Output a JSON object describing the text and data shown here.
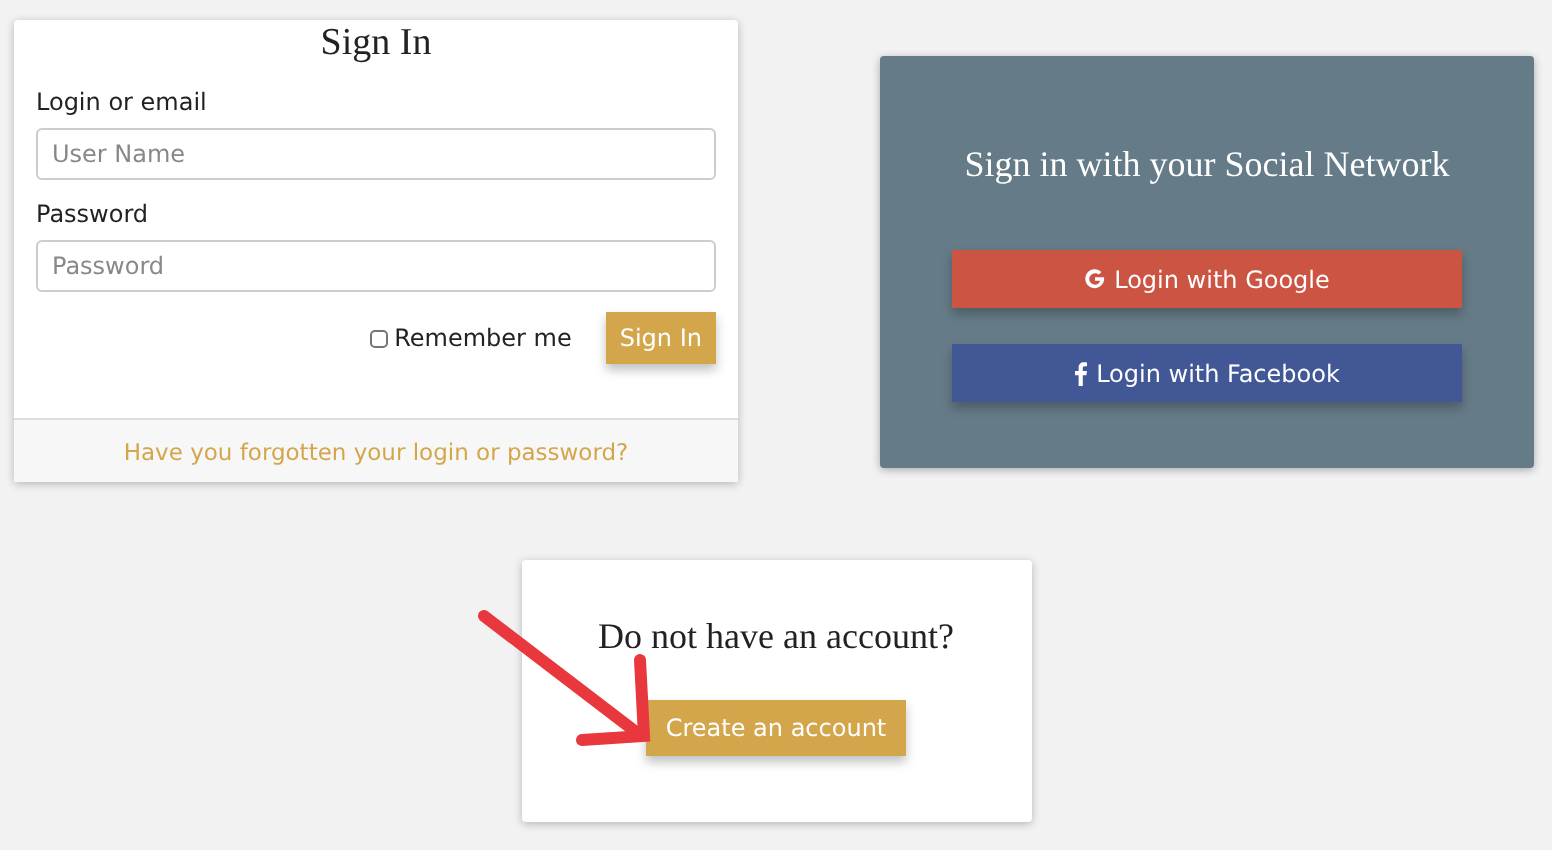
{
  "sign_in": {
    "title": "Sign In",
    "login_label": "Login or email",
    "login_placeholder": "User Name",
    "password_label": "Password",
    "password_placeholder": "Password",
    "remember": {
      "label": "Remember me",
      "checked": false
    },
    "submit": "Sign In",
    "forgot_link": "Have you forgotten your login or password?"
  },
  "social": {
    "title": "Sign in with your Social Network",
    "buttons": [
      {
        "kind": "google",
        "label": "Login with Google"
      },
      {
        "kind": "facebook",
        "label": "Login with Facebook"
      }
    ]
  },
  "register": {
    "title": "Do not have an account?",
    "button": "Create an account"
  }
}
